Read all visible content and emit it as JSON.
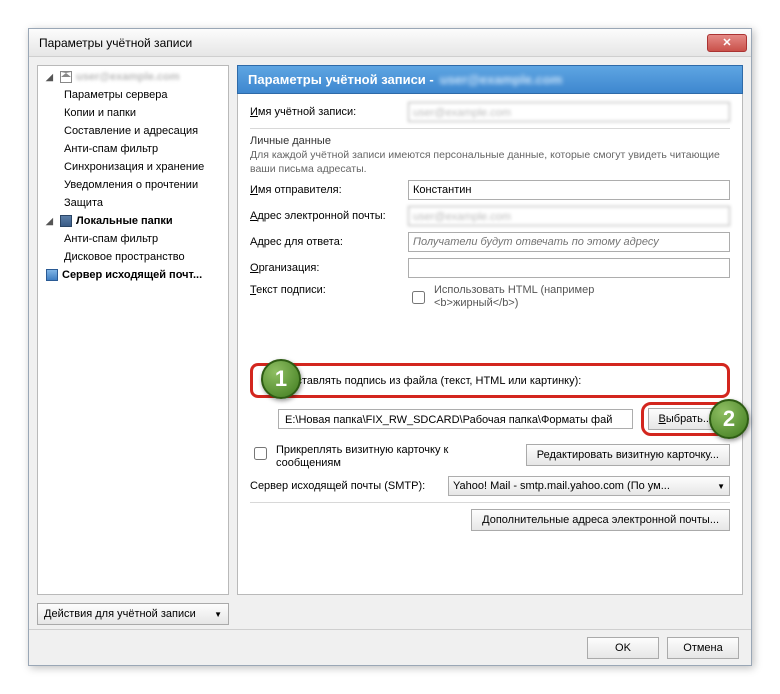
{
  "window": {
    "title": "Параметры учётной записи"
  },
  "sidebar": {
    "account_blurred": "user@example.com",
    "items": [
      "Параметры сервера",
      "Копии и папки",
      "Составление и адресация",
      "Анти-спам фильтр",
      "Синхронизация и хранение",
      "Уведомления о прочтении",
      "Защита"
    ],
    "local_folders": "Локальные папки",
    "local_children": [
      "Анти-спам фильтр",
      "Дисковое пространство"
    ],
    "smtp": "Сервер исходящей почт...",
    "actions_label": "Действия для учётной записи"
  },
  "banner": {
    "title": "Параметры учётной записи -",
    "account_blurred": "user@example.com"
  },
  "panel": {
    "account_name_label": "Имя учётной записи:",
    "personal_heading": "Личные данные",
    "personal_hint": "Для каждой учётной записи имеются персональные данные, которые смогут увидеть читающие ваши письма адресаты.",
    "sender_label": "Имя отправителя:",
    "sender_value": "Константин",
    "email_label": "Адрес электронной почты:",
    "reply_label": "Адрес для ответа:",
    "reply_placeholder": "Получатели будут отвечать по этому адресу",
    "org_label": "Организация:",
    "sig_text_label": "Текст подписи:",
    "use_html_label_1": "Использовать HTML (например",
    "use_html_label_2": "<b>жирный</b>)",
    "attach_from_file": "Вставлять подпись из файла (текст, HTML или картинку):",
    "file_path": "E:\\Новая папка\\FIX_RW_SDCARD\\Рабочая папка\\Форматы фай",
    "browse_btn": "Выбрать...",
    "vcard_label_1": "Прикреплять визитную карточку к",
    "vcard_label_2": "сообщениям",
    "edit_vcard_btn": "Редактировать визитную карточку...",
    "smtp_label": "Сервер исходящей почты (SMTP):",
    "smtp_value": "Yahoo! Mail - smtp.mail.yahoo.com (По ум...",
    "additional_btn": "Дополнительные адреса электронной почты..."
  },
  "badges": {
    "one": "1",
    "two": "2"
  },
  "footer": {
    "ok": "OK",
    "cancel": "Отмена"
  }
}
